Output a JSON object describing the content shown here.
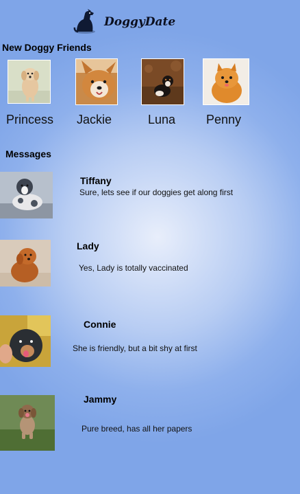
{
  "app": {
    "brand_name": "DoggyDate",
    "logo_icon": "dog-sitting-icon"
  },
  "friends_section": {
    "title": "New Doggy Friends",
    "friends": [
      {
        "name": "Princess",
        "photo": "dog-photo-golden-puppy"
      },
      {
        "name": "Jackie",
        "photo": "dog-photo-corgi-face"
      },
      {
        "name": "Luna",
        "photo": "dog-photo-tricolor-puppy"
      },
      {
        "name": "Penny",
        "photo": "dog-photo-pomeranian"
      }
    ]
  },
  "messages_section": {
    "title": "Messages",
    "messages": [
      {
        "sender": "Tiffany",
        "text": "Sure, lets see if our doggies get along first",
        "photo": "dog-photo-merle-aussie"
      },
      {
        "sender": "Lady",
        "text": "Yes, Lady is totally vaccinated",
        "photo": "dog-photo-red-poodle-puppy"
      },
      {
        "sender": "Connie",
        "text": "She is friendly, but a bit shy at first",
        "photo": "dog-photo-happy-mixed-dog"
      },
      {
        "sender": "Jammy",
        "text": "Pure breed, has all her papers",
        "photo": "dog-photo-yorkie-running"
      }
    ]
  }
}
